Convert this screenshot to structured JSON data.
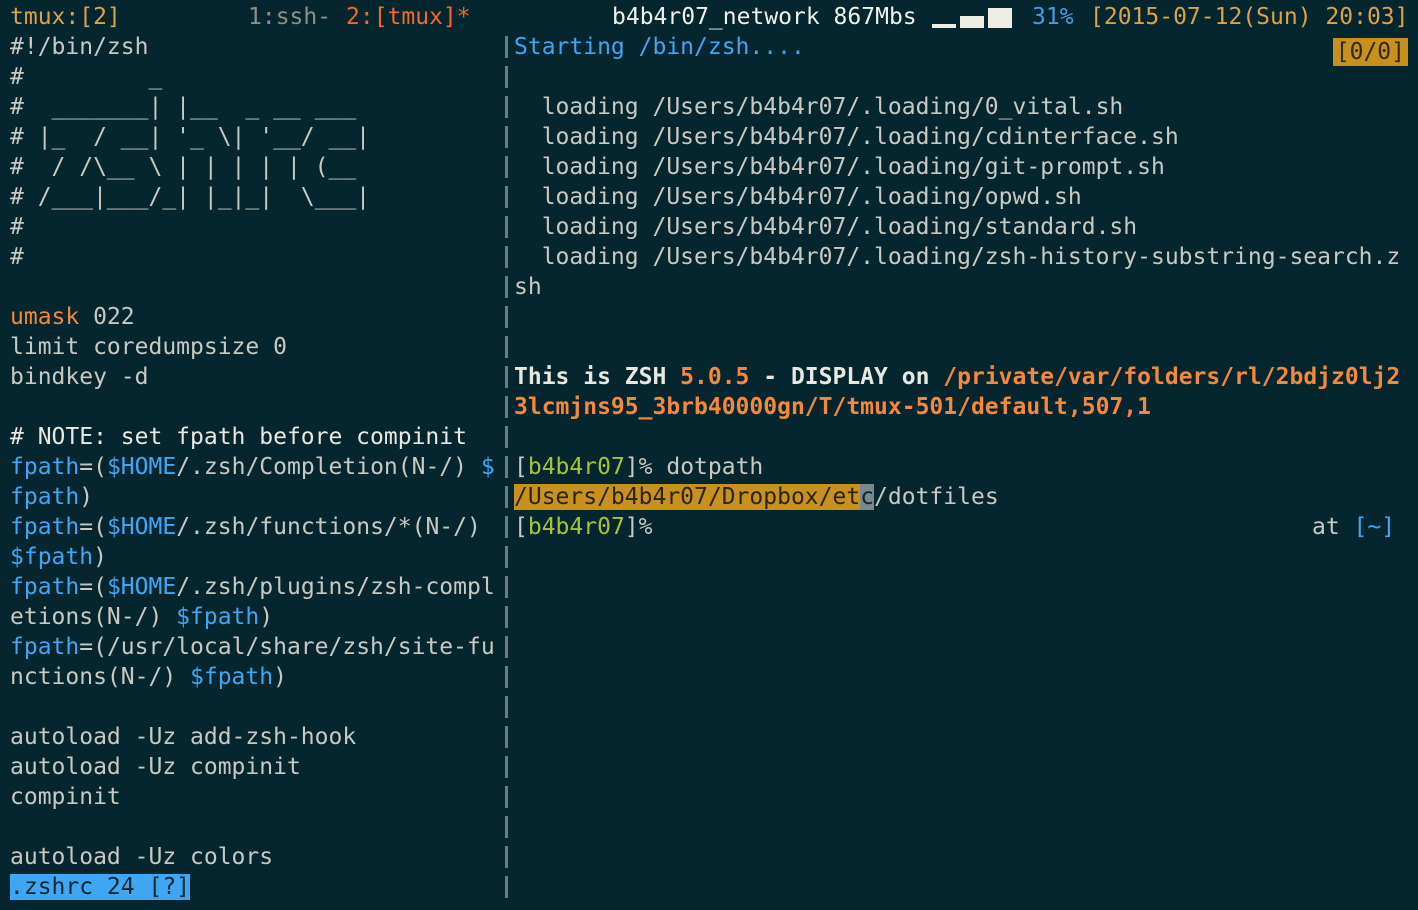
{
  "statusbar": {
    "session": "tmux:[2]",
    "window1": "1:ssh-",
    "window2": "2:[tmux]*",
    "network": "b4b4r07_network 867Mbs",
    "battery_percent": "31%",
    "datetime": "[2015-07-12(Sun) 20:03]",
    "battery_level": 0.31
  },
  "left_pane": {
    "lines": {
      "l0": "#!/bin/zsh",
      "l1": "#         _",
      "l2": "#  _______| |__  _ __ ___",
      "l3": "# |_  / __| '_ \\| '__/ __|",
      "l4": "#  / /\\__ \\ | | | | | (__",
      "l5": "# /___|___/_| |_|_|  \\___|",
      "l6": "#",
      "l7": "#",
      "umask_kw": "umask",
      "umask_val": " 022",
      "limit": "limit coredumpsize 0",
      "bindkey": "bindkey -d",
      "note": "# NOTE: set fpath before compinit",
      "fp1_a": "fpath",
      "fp1_b": "=(",
      "fp1_c": "$HOME",
      "fp1_d": "/.zsh/Completion(N-/) ",
      "fp1_e": "$",
      "fp1_f": "fpath",
      "fp1_g": ")",
      "fp2_a": "fpath",
      "fp2_b": "=(",
      "fp2_c": "$HOME",
      "fp2_d": "/.zsh/functions/*(N-/)",
      "fp2_e": "$fpath",
      "fp2_f": ")",
      "fp3_a": "fpath",
      "fp3_b": "=(",
      "fp3_c": "$HOME",
      "fp3_d": "/.zsh/plugins/zsh-compl",
      "fp3_e": "etions(N-/) ",
      "fp3_f": "$fpath",
      "fp3_g": ")",
      "fp4_a": "fpath",
      "fp4_b": "=(/usr/local/share/zsh/site-fu",
      "fp4_c": "nctions(N-/) ",
      "fp4_d": "$fpath",
      "fp4_e": ")",
      "auto1": "autoload -Uz add-zsh-hook",
      "auto2": "autoload -Uz compinit",
      "compinit": "compinit",
      "auto3": "autoload -Uz colors"
    },
    "vim_status": ".zshrc 24 [?]"
  },
  "right_pane": {
    "counter": "[0/0]",
    "starting": "Starting /bin/zsh....",
    "loading": [
      "  loading /Users/b4b4r07/.loading/0_vital.sh",
      "  loading /Users/b4b4r07/.loading/cdinterface.sh",
      "  loading /Users/b4b4r07/.loading/git-prompt.sh",
      "  loading /Users/b4b4r07/.loading/opwd.sh",
      "  loading /Users/b4b4r07/.loading/standard.sh",
      "  loading /Users/b4b4r07/.loading/zsh-history-substring-search.z"
    ],
    "loading_wrap": "sh",
    "zsh_a": "This is ZSH ",
    "zsh_version": "5.0.5",
    "zsh_b": " - DISPLAY on ",
    "display_1": "/private/var/folders/rl/2bdjz0lj2",
    "display_2": "3lcmjns95_3brb40000gn/T/tmux-501/default,507,1",
    "prompt_open": "[",
    "prompt_user": "b4b4r07",
    "prompt_close": "]%",
    "command": " dotpath",
    "out_hl": "/Users/b4b4r07/Dropbox/et",
    "out_cursor": "c",
    "out_rest": "/dotfiles",
    "prompt2_open": "[",
    "prompt2_user": "b4b4r07",
    "prompt2_close": "]%",
    "rprompt_at": "at ",
    "rprompt_dir": "[~]"
  }
}
